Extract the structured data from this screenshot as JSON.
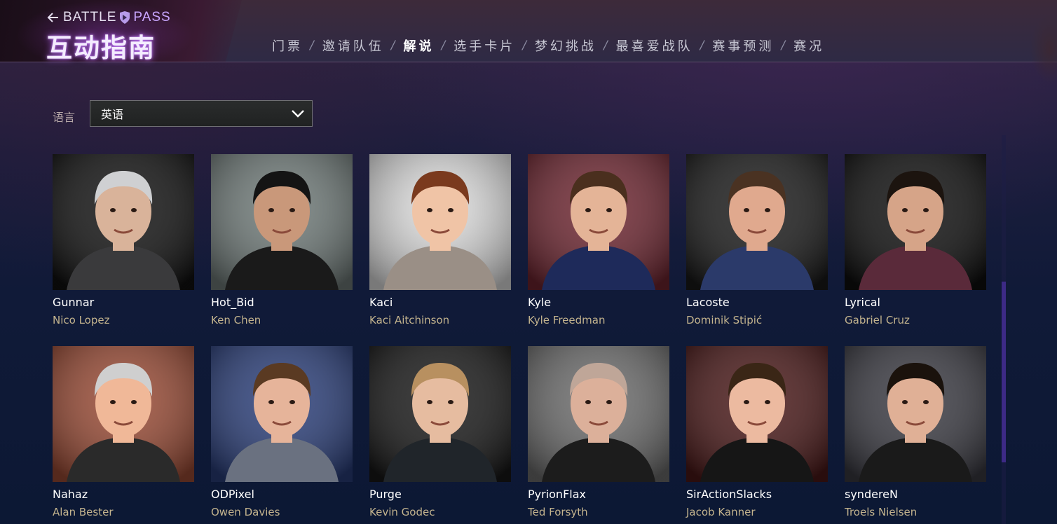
{
  "header": {
    "back_arrow_icon": "arrow-left-icon",
    "battle_label": "BATTLE",
    "pass_label": "PASS",
    "title": "互动指南",
    "accent": "#c9a6ff"
  },
  "nav": {
    "items": [
      {
        "label": "门票",
        "active": false
      },
      {
        "label": "邀请队伍",
        "active": false
      },
      {
        "label": "解说",
        "active": true
      },
      {
        "label": "选手卡片",
        "active": false
      },
      {
        "label": "梦幻挑战",
        "active": false
      },
      {
        "label": "最喜爱战队",
        "active": false
      },
      {
        "label": "赛事预测",
        "active": false
      },
      {
        "label": "赛况",
        "active": false
      }
    ],
    "separator": "/"
  },
  "language": {
    "label": "语言",
    "selected": "英语",
    "icon": "chevron-down-icon"
  },
  "casters": [
    {
      "handle": "Gunnar",
      "name": "Nico Lopez",
      "bg": "#111111",
      "skin": "#d9b39a",
      "hair": "#cfd0d2",
      "shirt": "#3a3a3c"
    },
    {
      "handle": "Hot_Bid",
      "name": "Ken Chen",
      "bg": "#6f7a78",
      "skin": "#c9987a",
      "hair": "#141414",
      "shirt": "#1a1a1a"
    },
    {
      "handle": "Kaci",
      "name": "Kaci Aitchinson",
      "bg": "#dcdcdc",
      "skin": "#f0c4a6",
      "hair": "#7a3a1e",
      "shirt": "#9a8f86"
    },
    {
      "handle": "Kyle",
      "name": "Kyle Freedman",
      "bg": "#6e2530",
      "skin": "#e4b497",
      "hair": "#4a2f1e",
      "shirt": "#1e2a5a"
    },
    {
      "handle": "Lacoste",
      "name": "Dominik Stipić",
      "bg": "#1a1a1a",
      "skin": "#e0a98e",
      "hair": "#4a3222",
      "shirt": "#2b3a6a"
    },
    {
      "handle": "Lyrical",
      "name": "Gabriel Cruz",
      "bg": "#0e0e0e",
      "skin": "#d6a488",
      "hair": "#1c140f",
      "shirt": "#5a2a3a"
    },
    {
      "handle": "Nahaz",
      "name": "Alan Bester",
      "bg": "#9a4a34",
      "skin": "#f0b898",
      "hair": "#cfcfcf",
      "shirt": "#2a2a2a"
    },
    {
      "handle": "ODPixel",
      "name": "Owen Davies",
      "bg": "#2a3e7a",
      "skin": "#e6b49a",
      "hair": "#5a3a22",
      "shirt": "#6a7180"
    },
    {
      "handle": "Purge",
      "name": "Kevin Godec",
      "bg": "#181818",
      "skin": "#e6bca0",
      "hair": "#b89060",
      "shirt": "#20252a"
    },
    {
      "handle": "PyrionFlax",
      "name": "Ted Forsyth",
      "bg": "#6c6c6c",
      "skin": "#dcb09a",
      "hair": "#bfa698",
      "shirt": "#1c1c1c"
    },
    {
      "handle": "SirActionSlacks",
      "name": "Jacob Kanner",
      "bg": "#4a1818",
      "skin": "#ecbaa0",
      "hair": "#3a2616",
      "shirt": "#161616"
    },
    {
      "handle": "syndereN",
      "name": "Troels Nielsen",
      "bg": "#3a3a42",
      "skin": "#e0b096",
      "hair": "#1a120c",
      "shirt": "#1a1a1a"
    }
  ]
}
